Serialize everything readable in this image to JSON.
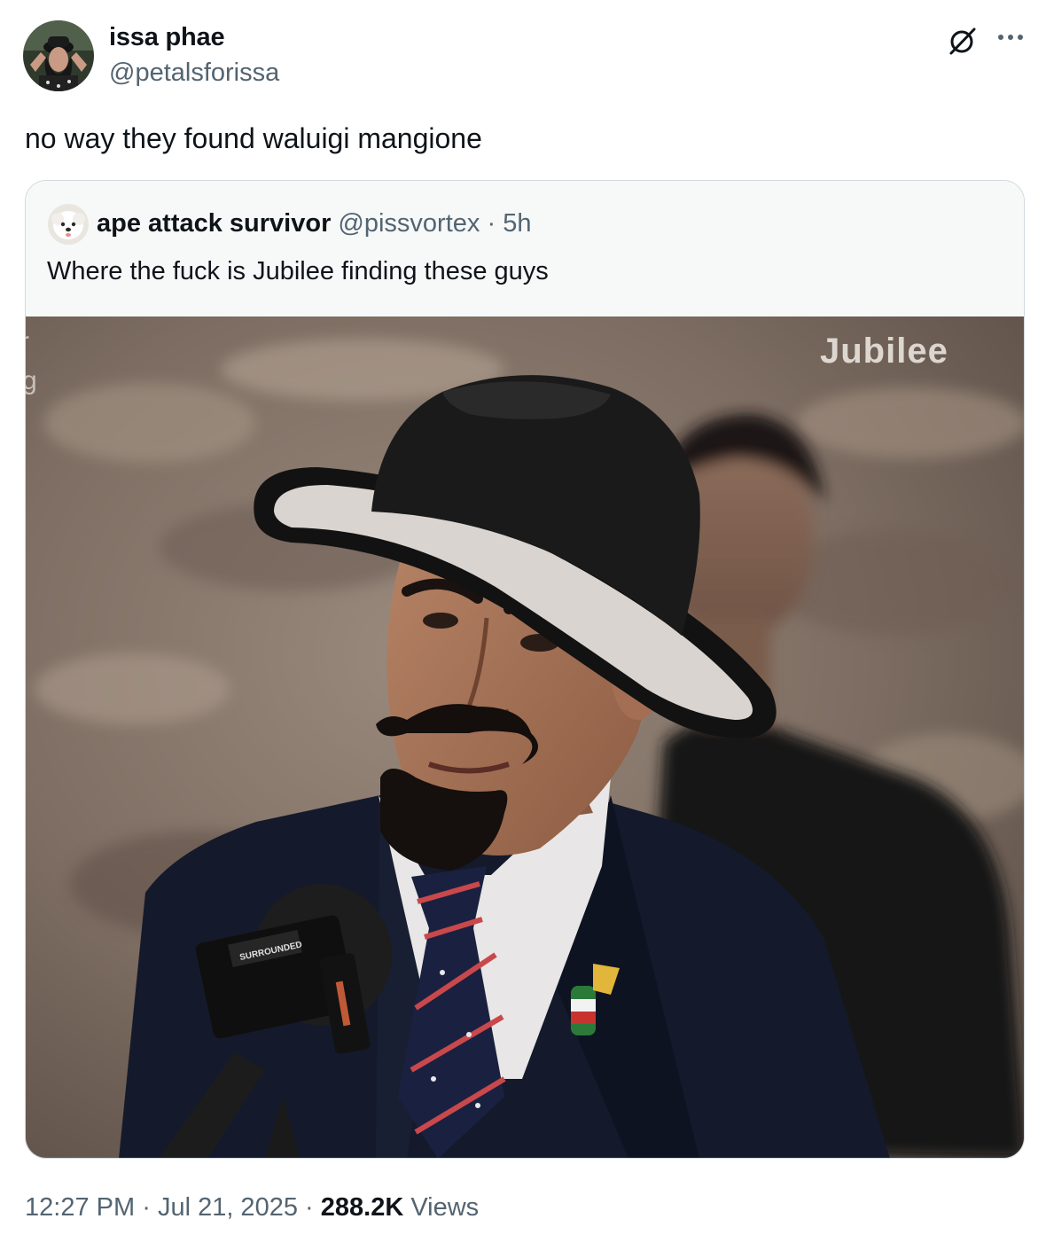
{
  "tweet": {
    "author": {
      "name": "issa phae",
      "handle": "@petalsforissa"
    },
    "text": "no way they found waluigi mangione",
    "quoted": {
      "author_name": "ape attack survivor",
      "author_handle": "@pissvortex",
      "separator": "·",
      "time": "5h",
      "text": "Where the fuck is Jubilee finding these guys",
      "media": {
        "watermark": "Jubilee",
        "edge_text_1": "r",
        "edge_text_2": "g",
        "mic_flag_text": "SURROUNDED"
      }
    },
    "footer": {
      "time": "12:27 PM",
      "separator": "·",
      "date": "Jul 21, 2025",
      "views_count": "288.2K",
      "views_label": "Views"
    }
  },
  "icons": {
    "grok": "grok-icon",
    "more": "more-icon"
  },
  "colors": {
    "text_primary": "#0f1419",
    "text_secondary": "#536471",
    "border": "#cfd9de",
    "quote_bg": "#f7f9f9"
  }
}
